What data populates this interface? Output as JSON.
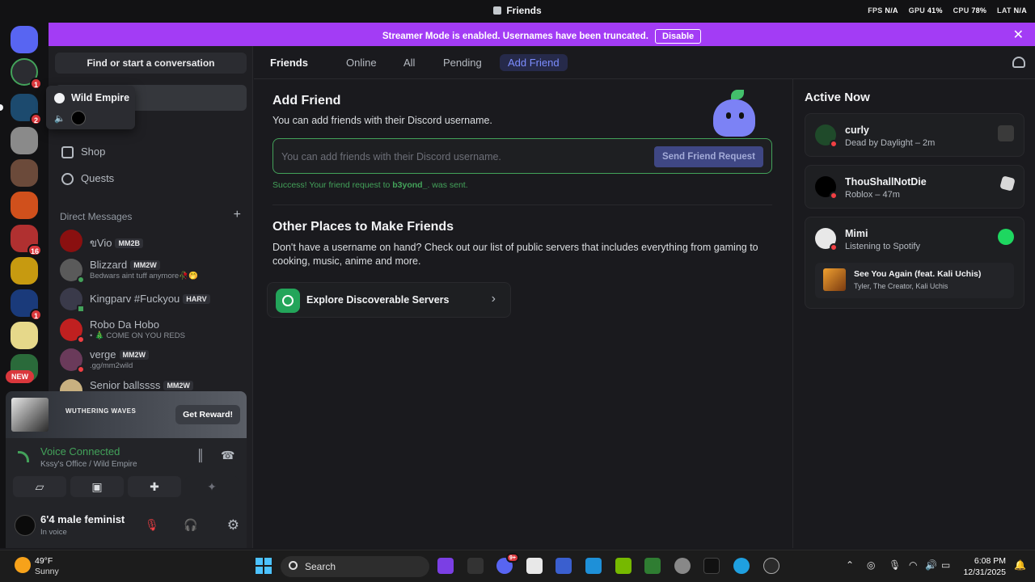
{
  "window": {
    "title": "Friends"
  },
  "perf": {
    "fps_label": "FPS",
    "fps": "N/A",
    "gpu_label": "GPU",
    "gpu": "41%",
    "cpu_label": "CPU",
    "cpu": "78%",
    "lat_label": "LAT",
    "lat": "N/A"
  },
  "streamer": {
    "message": "Streamer Mode is enabled. Usernames have been truncated.",
    "disable": "Disable"
  },
  "guilds": {
    "badges": [
      "1",
      "2",
      "16",
      "1"
    ],
    "new_label": "NEW"
  },
  "tooltip": {
    "server_name": "Wild Empire"
  },
  "sidebar": {
    "search": "Find or start a conversation",
    "nav": [
      {
        "label": "Shop"
      },
      {
        "label": "Quests"
      }
    ],
    "dm_header": "Direct Messages",
    "dms": [
      {
        "name": "ขVio",
        "tag": "MM2B",
        "sub": ""
      },
      {
        "name": "Blizzard",
        "tag": "MM2W",
        "sub": "Bedwars aint tuff anymore🥀🤭"
      },
      {
        "name": "Kingparv #Fuckyou",
        "tag": "HARV",
        "sub": ""
      },
      {
        "name": "Robo Da Hobo",
        "tag": "",
        "sub": "• 🎄 COME ON YOU REDS"
      },
      {
        "name": "verge",
        "tag": "MM2W",
        "sub": ".gg/mm2wild"
      },
      {
        "name": "Senior ballssss",
        "tag": "MM2W",
        "sub": ""
      }
    ]
  },
  "promo": {
    "logo": "WUTHERING WAVES",
    "button": "Get Reward!"
  },
  "voice": {
    "title": "Voice Connected",
    "channel": "Kssy's Office / Wild Empire"
  },
  "user": {
    "name": "6'4 male feminist",
    "status": "In voice"
  },
  "topbar": {
    "friends": "Friends",
    "tabs": [
      "Online",
      "All",
      "Pending"
    ],
    "add_friend": "Add Friend"
  },
  "add_friend": {
    "title": "Add Friend",
    "description": "You can add friends with their Discord username.",
    "placeholder": "You can add friends with their Discord username.",
    "send_button": "Send Friend Request",
    "success_prefix": "Success! Your friend request to ",
    "success_user": "b3yond_",
    "success_suffix": ". was sent."
  },
  "other_places": {
    "title": "Other Places to Make Friends",
    "description": "Don't have a username on hand? Check out our list of public servers that includes everything from gaming to cooking, music, anime and more.",
    "explore": "Explore Discoverable Servers"
  },
  "active_now": {
    "title": "Active Now",
    "cards": [
      {
        "name": "curly",
        "activity": "Dead by Daylight – 2m"
      },
      {
        "name": "ThouShallNotDie",
        "activity": "Roblox – 47m"
      },
      {
        "name": "Mimi",
        "activity": "Listening to Spotify",
        "song": "See You Again (feat. Kali Uchis)",
        "artist": "Tyler, The Creator, Kali Uchis"
      }
    ]
  },
  "taskbar": {
    "temp": "49°F",
    "condition": "Sunny",
    "search": "Search",
    "time": "6:08 PM",
    "date": "12/31/2025",
    "discord_badge": "9+"
  },
  "colors": {
    "accent": "#5865f2",
    "streamer_bar": "#a33cf5",
    "online": "#43a25a",
    "dnd": "#f23f43"
  }
}
